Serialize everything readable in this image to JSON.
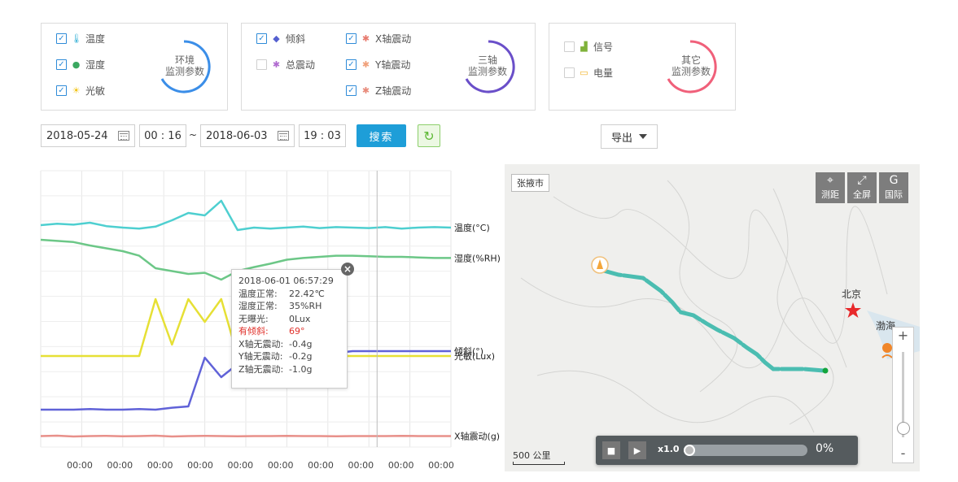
{
  "legend": {
    "env": {
      "items": [
        {
          "label": "温度",
          "checked": true,
          "icon": "thermometer-icon"
        },
        {
          "label": "湿度",
          "checked": true,
          "icon": "droplet-icon"
        },
        {
          "label": "光敏",
          "checked": true,
          "icon": "sun-icon"
        }
      ],
      "ring_label_1": "环境",
      "ring_label_2": "监测参数",
      "ring_color": "#3b8ee8"
    },
    "axis": {
      "items": [
        {
          "label": "倾斜",
          "checked": true,
          "icon": "tilt-icon"
        },
        {
          "label": "总震动",
          "checked": false,
          "icon": "vibration-icon"
        },
        {
          "label": "X轴震动",
          "checked": true,
          "icon": "vibration-icon"
        },
        {
          "label": "Y轴震动",
          "checked": true,
          "icon": "vibration-icon"
        },
        {
          "label": "Z轴震动",
          "checked": true,
          "icon": "vibration-icon"
        }
      ],
      "ring_label_1": "三轴",
      "ring_label_2": "监测参数",
      "ring_color": "#6a4fc9"
    },
    "other": {
      "items": [
        {
          "label": "信号",
          "checked": false,
          "icon": "signal-icon"
        },
        {
          "label": "电量",
          "checked": false,
          "icon": "battery-icon"
        }
      ],
      "ring_label_1": "其它",
      "ring_label_2": "监测参数",
      "ring_color": "#f0607a"
    }
  },
  "filters": {
    "start_date": "2018-05-24",
    "start_time": "00 : 16",
    "separator": "~",
    "end_date": "2018-06-03",
    "end_time": "19 : 03",
    "search_label": "搜索",
    "export_label": "导出"
  },
  "chart_data": {
    "type": "line",
    "series": [
      {
        "name": "温度(°C)",
        "color": "#4ecfd0",
        "values": [
          0.35,
          0.38,
          0.36,
          0.4,
          0.33,
          0.3,
          0.28,
          0.32,
          0.45,
          0.6,
          0.55,
          0.85,
          0.25,
          0.3,
          0.28,
          0.3,
          0.32,
          0.29,
          0.31,
          0.3,
          0.29,
          0.31,
          0.28,
          0.3,
          0.31,
          0.3
        ]
      },
      {
        "name": "湿度(%RH)",
        "color": "#6cc787",
        "values": [
          0.9,
          0.88,
          0.86,
          0.8,
          0.75,
          0.7,
          0.62,
          0.4,
          0.35,
          0.3,
          0.32,
          0.2,
          0.35,
          0.42,
          0.48,
          0.55,
          0.58,
          0.6,
          0.62,
          0.62,
          0.61,
          0.6,
          0.6,
          0.59,
          0.58,
          0.58
        ]
      },
      {
        "name": "光敏(Lux)",
        "color": "#e6e035",
        "values": [
          0,
          0,
          0,
          0,
          0,
          0,
          0,
          1,
          0.2,
          1,
          0.6,
          1,
          0,
          0,
          0,
          0,
          0,
          0,
          0,
          0,
          0,
          0,
          0,
          0,
          0,
          0
        ]
      },
      {
        "name": "倾斜(°)",
        "color": "#6062d8",
        "values": [
          0.05,
          0.05,
          0.05,
          0.06,
          0.05,
          0.05,
          0.06,
          0.05,
          0.08,
          0.1,
          0.85,
          0.55,
          0.75,
          0.85,
          0.85,
          0.85,
          0.88,
          0.9,
          0.92,
          0.95,
          0.95,
          0.95,
          0.95,
          0.95,
          0.95,
          0.95
        ]
      },
      {
        "name": "X轴震动(g)",
        "color": "#e8908a",
        "values": [
          0.5,
          0.52,
          0.48,
          0.5,
          0.51,
          0.49,
          0.5,
          0.52,
          0.48,
          0.5,
          0.51,
          0.5,
          0.49,
          0.5,
          0.5,
          0.51,
          0.5,
          0.5,
          0.49,
          0.5,
          0.5,
          0.5,
          0.51,
          0.5,
          0.5,
          0.5
        ]
      }
    ],
    "x_tick_labels": [
      "00:00",
      "00:00",
      "00:00",
      "00:00",
      "00:00",
      "00:00",
      "00:00",
      "00:00",
      "00:00",
      "00:00"
    ],
    "grid": true,
    "cursor_position": 0.82
  },
  "tooltip": {
    "time": "2018-06-01 06:57:29",
    "rows": [
      {
        "k": "温度正常:",
        "v": "22.42℃",
        "warn": false
      },
      {
        "k": "湿度正常:",
        "v": "35%RH",
        "warn": false
      },
      {
        "k": "无曝光:",
        "v": "0Lux",
        "warn": false
      },
      {
        "k": "有倾斜:",
        "v": "69°",
        "warn": true
      },
      {
        "k": "X轴无震动:",
        "v": "-0.4g",
        "warn": false
      },
      {
        "k": "Y轴无震动:",
        "v": "-0.2g",
        "warn": false
      },
      {
        "k": "Z轴无震动:",
        "v": "-1.0g",
        "warn": false
      }
    ]
  },
  "map": {
    "city_badge": "张掖市",
    "tools": [
      {
        "label": "测距",
        "icon": "ruler-icon"
      },
      {
        "label": "全屏",
        "icon": "fullscreen-icon"
      },
      {
        "label": "国际",
        "icon": "globe-icon"
      }
    ],
    "beijing_label": "北京",
    "bohai_label": "渤海",
    "scale_label": "500 公里",
    "player": {
      "speed": "x1.0",
      "progress_text": "0%",
      "progress": 0
    },
    "route_color": "#4bbdb1"
  }
}
